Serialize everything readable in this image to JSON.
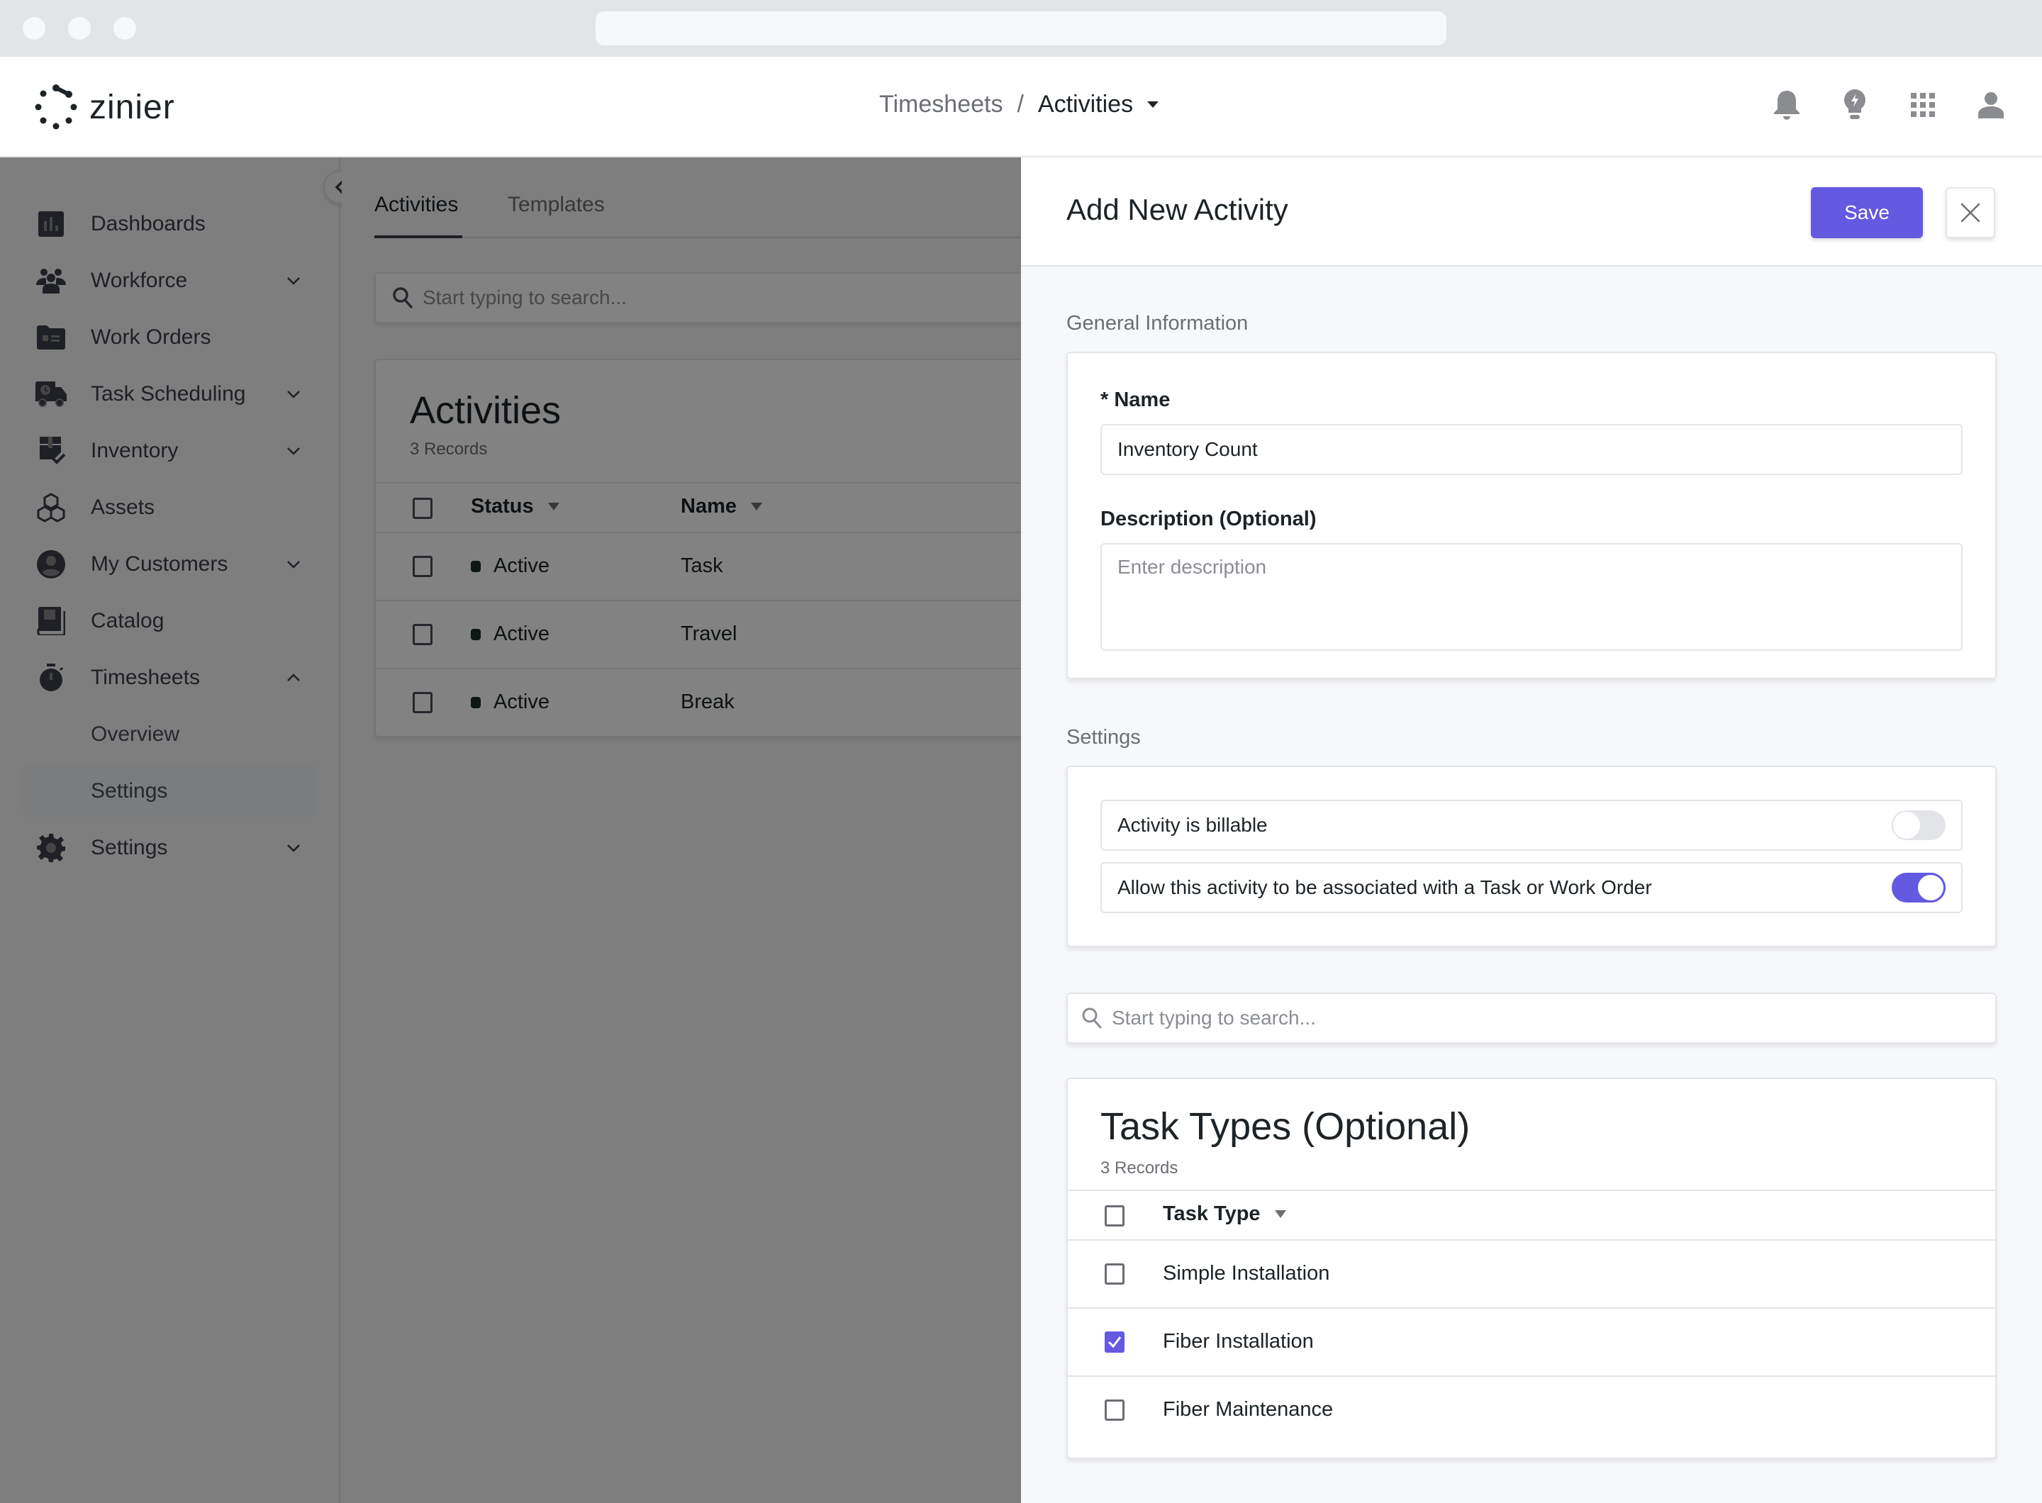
{
  "brand": {
    "name": "zinier"
  },
  "breadcrumb": {
    "parent": "Timesheets",
    "separator": "/",
    "current": "Activities"
  },
  "header_icons": [
    "bell-icon",
    "lightbulb-icon",
    "apps-grid-icon",
    "user-icon"
  ],
  "sidebar": {
    "items": [
      {
        "label": "Dashboards",
        "icon": "bar-chart-icon",
        "expandable": false
      },
      {
        "label": "Workforce",
        "icon": "people-icon",
        "expandable": true,
        "expanded": false
      },
      {
        "label": "Work Orders",
        "icon": "folder-icon",
        "expandable": false
      },
      {
        "label": "Task Scheduling",
        "icon": "truck-clock-icon",
        "expandable": true,
        "expanded": false
      },
      {
        "label": "Inventory",
        "icon": "box-check-icon",
        "expandable": true,
        "expanded": false
      },
      {
        "label": "Assets",
        "icon": "cubes-icon",
        "expandable": false
      },
      {
        "label": "My Customers",
        "icon": "account-circle-icon",
        "expandable": true,
        "expanded": false
      },
      {
        "label": "Catalog",
        "icon": "book-icon",
        "expandable": false
      },
      {
        "label": "Timesheets",
        "icon": "stopwatch-icon",
        "expandable": true,
        "expanded": true
      },
      {
        "label": "Overview",
        "sub": true
      },
      {
        "label": "Settings",
        "sub": true,
        "selected": true
      },
      {
        "label": "Settings",
        "icon": "gear-icon",
        "expandable": true,
        "expanded": false
      }
    ]
  },
  "main": {
    "tabs": [
      {
        "label": "Activities",
        "active": true
      },
      {
        "label": "Templates",
        "active": false
      }
    ],
    "search_placeholder": "Start typing to search...",
    "card": {
      "title": "Activities",
      "records": "3 Records",
      "columns": [
        "Status",
        "Name"
      ],
      "rows": [
        {
          "status": "Active",
          "name": "Task"
        },
        {
          "status": "Active",
          "name": "Travel"
        },
        {
          "status": "Active",
          "name": "Break"
        }
      ]
    }
  },
  "panel": {
    "title": "Add New Activity",
    "save_label": "Save",
    "general": {
      "section_label": "General Information",
      "name_label": "* Name",
      "name_value": "Inventory Count",
      "description_label": "Description (Optional)",
      "description_placeholder": "Enter description",
      "description_value": ""
    },
    "settings": {
      "section_label": "Settings",
      "toggles": [
        {
          "label": "Activity is billable",
          "on": false
        },
        {
          "label": "Allow this activity to be associated with a Task or Work Order",
          "on": true
        }
      ]
    },
    "search_placeholder": "Start typing to search...",
    "task_types": {
      "title": "Task Types (Optional)",
      "records": "3 Records",
      "column": "Task Type",
      "rows": [
        {
          "label": "Simple Installation",
          "checked": false
        },
        {
          "label": "Fiber Installation",
          "checked": true
        },
        {
          "label": "Fiber Maintenance",
          "checked": false
        }
      ]
    }
  },
  "colors": {
    "accent": "#6459e1",
    "text": "#1d2326",
    "muted": "#6b6e73",
    "border": "#e4e5ea"
  }
}
